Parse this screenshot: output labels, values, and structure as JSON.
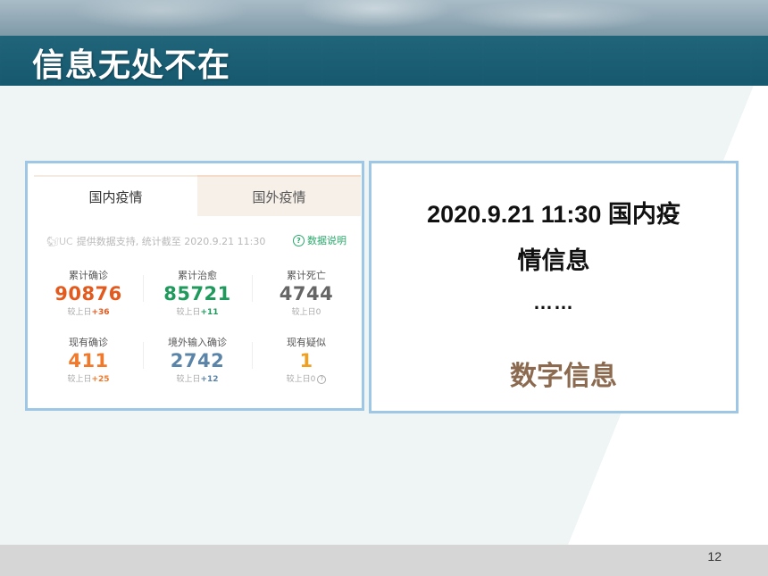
{
  "slide": {
    "title": "信息无处不在",
    "page_number": "12"
  },
  "covid_card": {
    "tabs": [
      {
        "label": "国内疫情",
        "active": true
      },
      {
        "label": "国外疫情",
        "active": false
      }
    ],
    "source_logo": "UC",
    "source_text": "提供数据支持, 统计截至 2020.9.21 11:30",
    "explain_label": "数据说明",
    "stats": [
      {
        "label": "累计确诊",
        "value": "90876",
        "delta_prefix": "较上日",
        "delta": "+36",
        "color": "#e35a1e",
        "delta_color": "#e35a1e"
      },
      {
        "label": "累计治愈",
        "value": "85721",
        "delta_prefix": "较上日",
        "delta": "+11",
        "color": "#1f9a5c",
        "delta_color": "#1f9a5c"
      },
      {
        "label": "累计死亡",
        "value": "4744",
        "delta_prefix": "较上日",
        "delta": "0",
        "color": "#666666",
        "delta_color": "#aaaaaa"
      },
      {
        "label": "现有确诊",
        "value": "411",
        "delta_prefix": "较上日",
        "delta": "+25",
        "color": "#f0792b",
        "delta_color": "#f0792b"
      },
      {
        "label": "境外输入确诊",
        "value": "2742",
        "delta_prefix": "较上日",
        "delta": "+12",
        "color": "#5a84a8",
        "delta_color": "#5a84a8"
      },
      {
        "label": "现有疑似",
        "value": "1",
        "delta_prefix": "较上日",
        "delta": "0",
        "color": "#f0a020",
        "delta_color": "#aaaaaa"
      }
    ]
  },
  "info_panel": {
    "line1": "2020.9.21 11:30  国内疫",
    "line2": "情信息",
    "ellipsis": "……",
    "highlight": "数字信息",
    "highlight_color": "#8b6a4f"
  }
}
